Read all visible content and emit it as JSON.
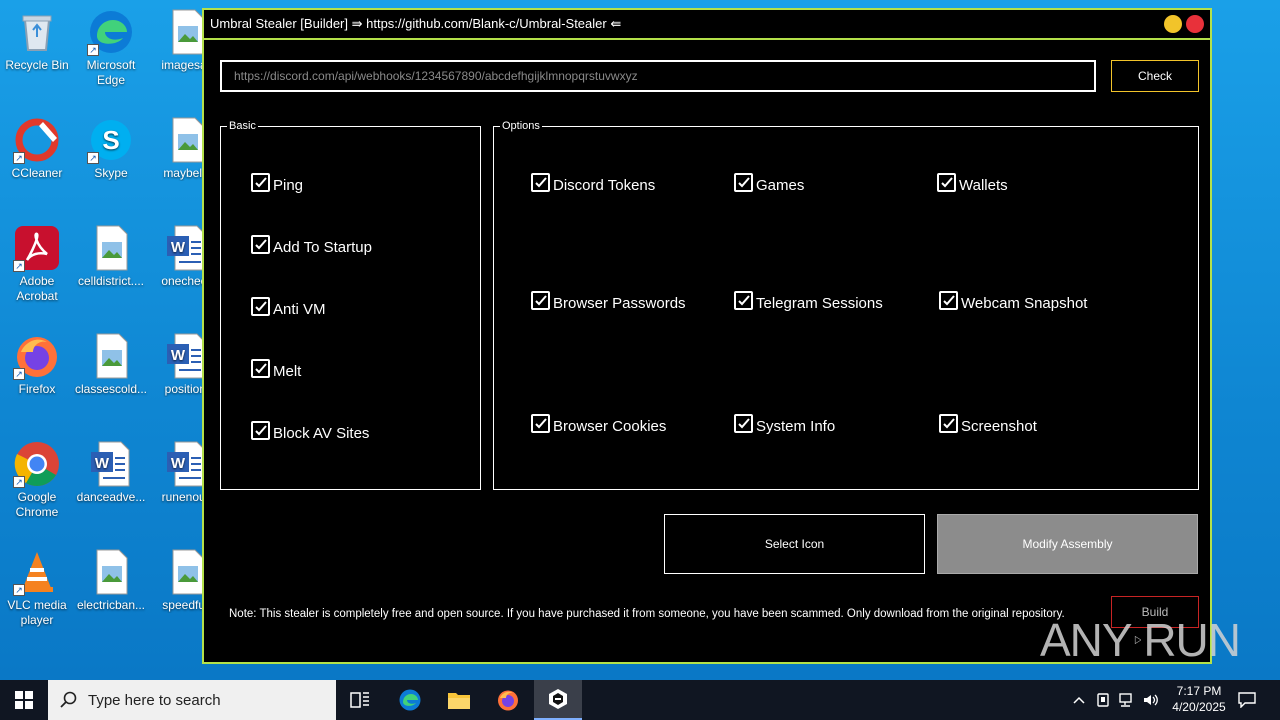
{
  "desktop": {
    "icons": [
      {
        "label": "Recycle Bin"
      },
      {
        "label": "Microsoft Edge"
      },
      {
        "label": "imagesac"
      },
      {
        "label": "CCleaner"
      },
      {
        "label": "Skype"
      },
      {
        "label": "maybelis"
      },
      {
        "label": "Adobe Acrobat"
      },
      {
        "label": "celldistrict...."
      },
      {
        "label": "onecheck"
      },
      {
        "label": "Firefox"
      },
      {
        "label": "classescold..."
      },
      {
        "label": "positiont"
      },
      {
        "label": "Google Chrome"
      },
      {
        "label": "danceadve..."
      },
      {
        "label": "runenoug"
      },
      {
        "label": "VLC media player"
      },
      {
        "label": "electricban..."
      },
      {
        "label": "speedfun"
      }
    ]
  },
  "window": {
    "title": "Umbral Stealer [Builder] ⇛ https://github.com/Blank-c/Umbral-Stealer ⇚",
    "webhook_placeholder": "https://discord.com/api/webhooks/1234567890/abcdefhgijklmnopqrstuvwxyz",
    "check_label": "Check",
    "basic": {
      "legend": "Basic",
      "items": [
        {
          "label": "Ping",
          "checked": true
        },
        {
          "label": "Add To Startup",
          "checked": true
        },
        {
          "label": "Anti VM",
          "checked": true
        },
        {
          "label": "Melt",
          "checked": true
        },
        {
          "label": "Block AV Sites",
          "checked": true
        }
      ]
    },
    "options": {
      "legend": "Options",
      "items": [
        {
          "label": "Discord Tokens",
          "checked": true
        },
        {
          "label": "Games",
          "checked": true
        },
        {
          "label": "Wallets",
          "checked": true
        },
        {
          "label": "Browser Passwords",
          "checked": true
        },
        {
          "label": "Telegram Sessions",
          "checked": true
        },
        {
          "label": "Webcam Snapshot",
          "checked": true
        },
        {
          "label": "Browser Cookies",
          "checked": true
        },
        {
          "label": "System Info",
          "checked": true
        },
        {
          "label": "Screenshot",
          "checked": true
        }
      ]
    },
    "select_icon_label": "Select Icon",
    "modify_assembly_label": "Modify Assembly",
    "build_label": "Build",
    "note": "Note: This stealer is completely free and open source. If you have purchased it from someone, you have been scammed. Only download from the original repository."
  },
  "watermark": {
    "left": "ANY",
    "right": "RUN"
  },
  "taskbar": {
    "search_placeholder": "Type here to search",
    "time": "7:17 PM",
    "date": "4/20/2025"
  },
  "colors": {
    "accent": "#b4e14a",
    "minimize": "#f2c42a",
    "close": "#e8313a",
    "build_border": "#c82424"
  }
}
